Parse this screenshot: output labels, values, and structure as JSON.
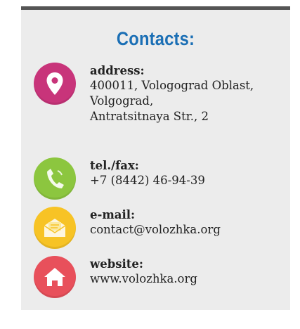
{
  "title": "Contacts:",
  "contacts": [
    {
      "label": "address:",
      "value": "400011, Vologograd Oblast,\nVolgograd,\nAntratsitnaya Str., 2",
      "icon": "location-pin-icon",
      "color": "#c8347a"
    },
    {
      "label": "tel./fax:",
      "value": "+7 (8442) 46-94-39",
      "icon": "phone-icon",
      "color": "#8cc63f"
    },
    {
      "label": "e-mail:",
      "value": "contact@volozhka.org",
      "icon": "envelope-icon",
      "color": "#f7c325"
    },
    {
      "label": "website:",
      "value": "www.volozhka.org",
      "icon": "home-icon",
      "color": "#e8505b"
    }
  ]
}
